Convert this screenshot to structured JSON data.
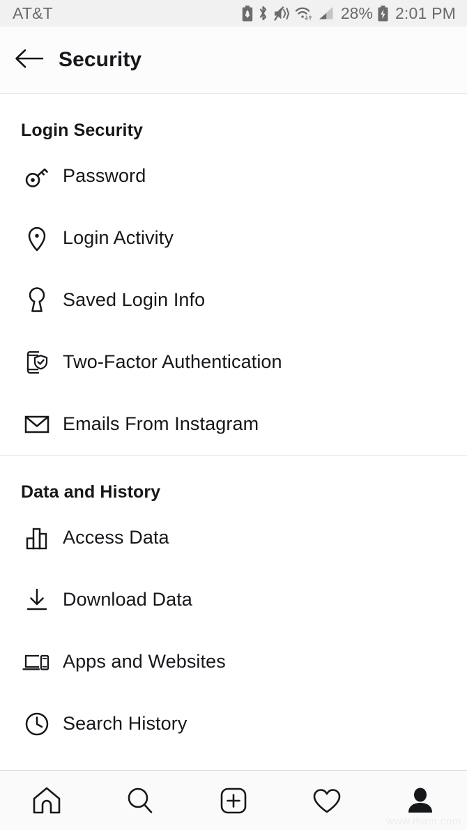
{
  "statusbar": {
    "carrier": "AT&T",
    "battery_percent": "28%",
    "time": "2:01 PM",
    "icons": [
      "battery-saver-icon",
      "bluetooth-icon",
      "vibrate-mute-icon",
      "wifi-icon",
      "cellular-signal-icon",
      "battery-charging-icon"
    ],
    "text_color": "#6b6b6b",
    "background": "#f1f1f1"
  },
  "header": {
    "back_label": "back-arrow",
    "title": "Security"
  },
  "sections": [
    {
      "title": "Login Security",
      "items": [
        {
          "label": "Password",
          "icon": "key-icon"
        },
        {
          "label": "Login Activity",
          "icon": "location-pin-icon"
        },
        {
          "label": "Saved Login Info",
          "icon": "keyhole-icon"
        },
        {
          "label": "Two-Factor Authentication",
          "icon": "phone-shield-check-icon"
        },
        {
          "label": "Emails From Instagram",
          "icon": "envelope-icon"
        }
      ]
    },
    {
      "title": "Data and History",
      "items": [
        {
          "label": "Access Data",
          "icon": "bar-chart-icon"
        },
        {
          "label": "Download Data",
          "icon": "download-arrow-icon"
        },
        {
          "label": "Apps and Websites",
          "icon": "laptop-phone-icon"
        },
        {
          "label": "Search History",
          "icon": "clock-history-icon"
        }
      ]
    }
  ],
  "navbar": {
    "items": [
      {
        "name": "home",
        "icon": "home-icon"
      },
      {
        "name": "search",
        "icon": "search-icon"
      },
      {
        "name": "create",
        "icon": "plus-square-icon"
      },
      {
        "name": "activity",
        "icon": "heart-icon"
      },
      {
        "name": "profile",
        "icon": "person-filled-icon"
      }
    ]
  },
  "watermark": "www.ifiam.com",
  "colors": {
    "text_primary": "#15171a",
    "divider": "#ededed",
    "background": "#ffffff",
    "statusbar_bg": "#f1f1f1",
    "navbar_bg": "#fafafa"
  }
}
